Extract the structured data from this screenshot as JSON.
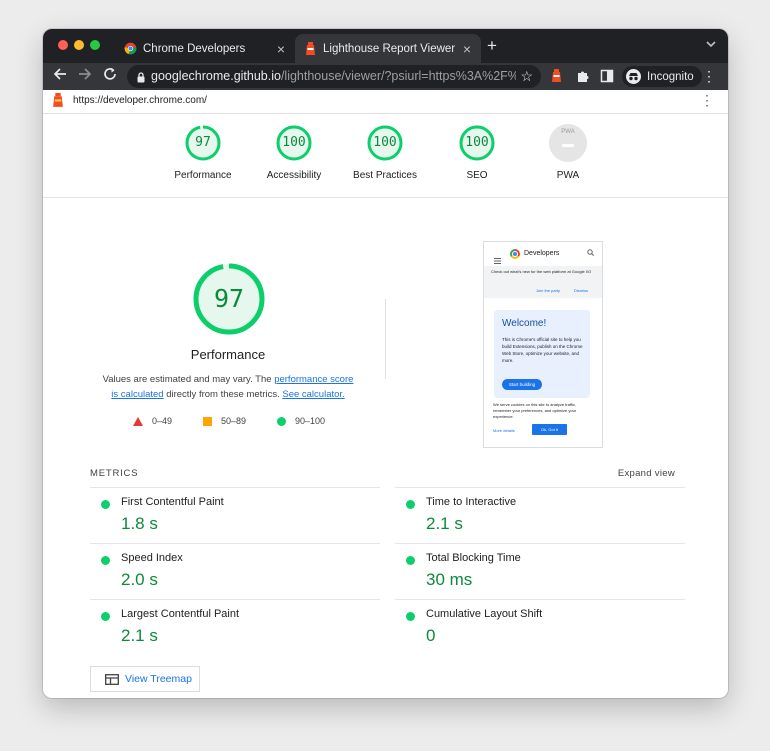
{
  "browser": {
    "tabs": [
      {
        "title": "Chrome Developers",
        "close": "×"
      },
      {
        "title": "Lighthouse Report Viewer",
        "close": "×"
      }
    ],
    "new_tab": "+",
    "url_host": "googlechrome.github.io",
    "url_path": "/lighthouse/viewer/?psiurl=https%3A%2F%2F...",
    "incognito_label": "Incognito"
  },
  "report": {
    "url": "https://developer.chrome.com/",
    "categories": [
      {
        "score": "97",
        "label": "Performance",
        "fraction": 0.97
      },
      {
        "score": "100",
        "label": "Accessibility",
        "fraction": 1.0
      },
      {
        "score": "100",
        "label": "Best Practices",
        "fraction": 1.0
      },
      {
        "score": "100",
        "label": "SEO",
        "fraction": 1.0
      },
      {
        "score": "",
        "label": "PWA",
        "badge": "PWA"
      }
    ],
    "performance": {
      "score": "97",
      "title": "Performance",
      "desc_prefix": "Values are estimated and may vary. The ",
      "desc_link1": "performance score is calculated",
      "desc_mid": " directly from these metrics. ",
      "desc_link2": "See calculator."
    },
    "legend": [
      {
        "range": "0–49",
        "color": "#e53935"
      },
      {
        "range": "50–89",
        "color": "#ffa400"
      },
      {
        "range": "90–100",
        "color": "#0cce6b"
      }
    ],
    "screenshot": {
      "brand": "Developers",
      "banner_text": "Check out what's new for the web platform at Google I/O",
      "banner_join": "Join the party",
      "banner_dismiss": "Dismiss",
      "welcome": "Welcome!",
      "card_text": "This is Chrome's official site to help you build Extensions, publish on the Chrome Web Store, optimize your website, and more.",
      "card_button": "Start building",
      "cookie_text": "We serve cookies on this site to analyze traffic, remember your preferences, and optimize your experience.",
      "more_details": "More details",
      "ok": "Ok, Got it"
    },
    "metrics_header": "METRICS",
    "expand_view": "Expand view",
    "metrics": [
      {
        "name": "First Contentful Paint",
        "value": "1.8 s"
      },
      {
        "name": "Time to Interactive",
        "value": "2.1 s"
      },
      {
        "name": "Speed Index",
        "value": "2.0 s"
      },
      {
        "name": "Total Blocking Time",
        "value": "30 ms"
      },
      {
        "name": "Largest Contentful Paint",
        "value": "2.1 s"
      },
      {
        "name": "Cumulative Layout Shift",
        "value": "0"
      }
    ],
    "treemap_button": "View Treemap"
  }
}
